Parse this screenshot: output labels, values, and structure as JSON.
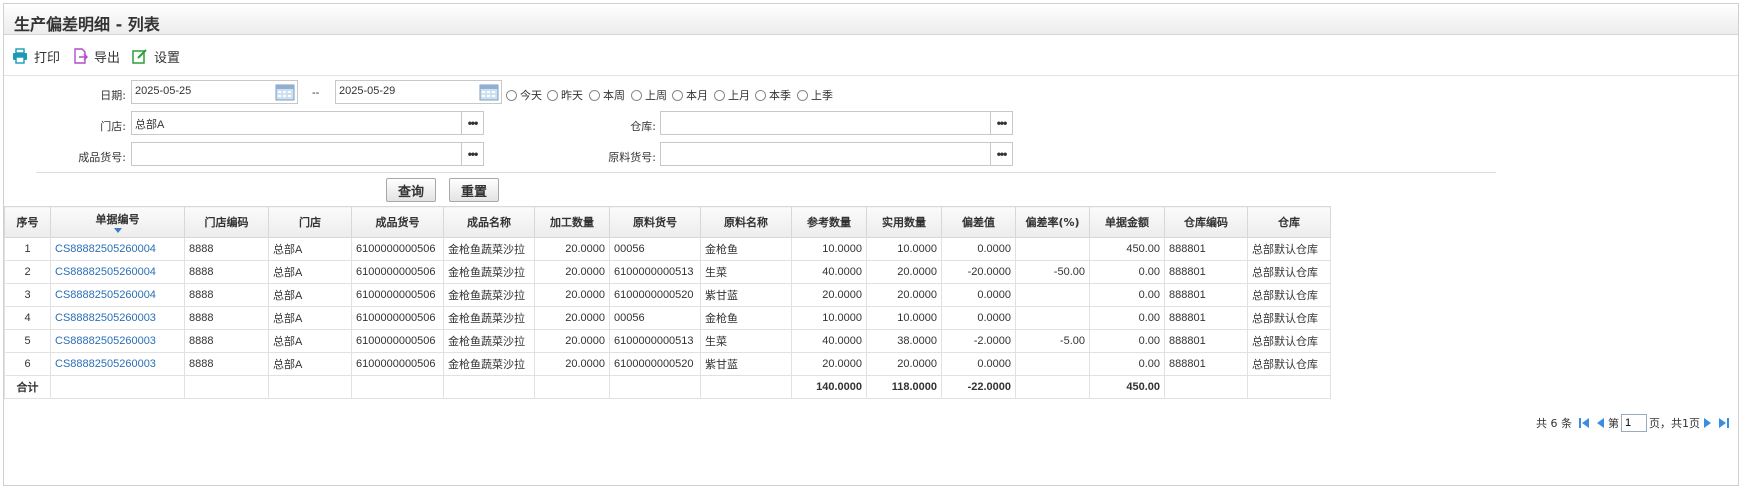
{
  "title": "生产偏差明细 - 列表",
  "toolbar": {
    "print": "打印",
    "export": "导出",
    "settings": "设置"
  },
  "filters": {
    "date_label": "日期:",
    "date_from": "2025-05-25",
    "date_sep": "--",
    "date_to": "2025-05-29",
    "ranges": [
      "今天",
      "昨天",
      "本周",
      "上周",
      "本月",
      "上月",
      "本季",
      "上季"
    ],
    "store_label": "门店:",
    "store_value": "总部A",
    "warehouse_label": "仓库:",
    "warehouse_value": "",
    "product_label": "成品货号:",
    "product_value": "",
    "material_label": "原料货号:",
    "material_value": "",
    "query_button": "查询",
    "reset_button": "重置"
  },
  "table": {
    "headers": [
      "序号",
      "单据编号",
      "门店编码",
      "门店",
      "成品货号",
      "成品名称",
      "加工数量",
      "原料货号",
      "原料名称",
      "参考数量",
      "实用数量",
      "偏差值",
      "偏差率(%)",
      "单据金额",
      "仓库编码",
      "仓库"
    ],
    "rows": [
      [
        "1",
        "CS88882505260004",
        "8888",
        "总部A",
        "6100000000506",
        "金枪鱼蔬菜沙拉",
        "20.0000",
        "00056",
        "金枪鱼",
        "10.0000",
        "10.0000",
        "0.0000",
        "",
        "450.00",
        "888801",
        "总部默认仓库"
      ],
      [
        "2",
        "CS88882505260004",
        "8888",
        "总部A",
        "6100000000506",
        "金枪鱼蔬菜沙拉",
        "20.0000",
        "6100000000513",
        "生菜",
        "40.0000",
        "20.0000",
        "-20.0000",
        "-50.00",
        "0.00",
        "888801",
        "总部默认仓库"
      ],
      [
        "3",
        "CS88882505260004",
        "8888",
        "总部A",
        "6100000000506",
        "金枪鱼蔬菜沙拉",
        "20.0000",
        "6100000000520",
        "紫甘蓝",
        "20.0000",
        "20.0000",
        "0.0000",
        "",
        "0.00",
        "888801",
        "总部默认仓库"
      ],
      [
        "4",
        "CS88882505260003",
        "8888",
        "总部A",
        "6100000000506",
        "金枪鱼蔬菜沙拉",
        "20.0000",
        "00056",
        "金枪鱼",
        "10.0000",
        "10.0000",
        "0.0000",
        "",
        "0.00",
        "888801",
        "总部默认仓库"
      ],
      [
        "5",
        "CS88882505260003",
        "8888",
        "总部A",
        "6100000000506",
        "金枪鱼蔬菜沙拉",
        "20.0000",
        "6100000000513",
        "生菜",
        "40.0000",
        "38.0000",
        "-2.0000",
        "-5.00",
        "0.00",
        "888801",
        "总部默认仓库"
      ],
      [
        "6",
        "CS88882505260003",
        "8888",
        "总部A",
        "6100000000506",
        "金枪鱼蔬菜沙拉",
        "20.0000",
        "6100000000520",
        "紫甘蓝",
        "20.0000",
        "20.0000",
        "0.0000",
        "",
        "0.00",
        "888801",
        "总部默认仓库"
      ]
    ],
    "total": [
      "合计",
      "",
      "",
      "",
      "",
      "",
      "",
      "",
      "",
      "140.0000",
      "118.0000",
      "-22.0000",
      "",
      "450.00",
      "",
      ""
    ]
  },
  "pager": {
    "total_text": "共 6 条",
    "page_prefix": "第",
    "page_value": "1",
    "page_suffix": "页，共1页"
  },
  "colors": {
    "link": "#2a6fb5",
    "print_icon": "#1a9bb5",
    "export_icon": "#b04fc4",
    "settings_icon": "#2e9e3a",
    "pager_arrow": "#3b8de0"
  }
}
